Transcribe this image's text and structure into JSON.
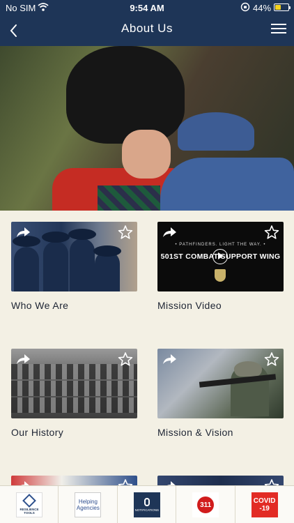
{
  "status_bar": {
    "carrier": "No SIM",
    "time": "9:54 AM",
    "battery": "44%"
  },
  "nav": {
    "title": "About Us"
  },
  "cards": [
    {
      "label": "Who We Are"
    },
    {
      "label": "Mission Video",
      "video_motto": "• PATHFINDERS. LIGHT THE WAY. •",
      "video_title": "501ST COMBAT SUPPORT WING"
    },
    {
      "label": "Our History"
    },
    {
      "label": "Mission & Vision"
    },
    {
      "label": ""
    },
    {
      "label": ""
    }
  ],
  "tabs": [
    {
      "text": "RESILIENCE TOOLS"
    },
    {
      "text": "Helping Agencies"
    },
    {
      "text": "NOTIFICATIONS"
    },
    {
      "text": "311"
    },
    {
      "text": "COVID -19"
    }
  ],
  "colors": {
    "header": "#1e3557",
    "background": "#f3f0e4",
    "battery": "#f4d21f"
  }
}
